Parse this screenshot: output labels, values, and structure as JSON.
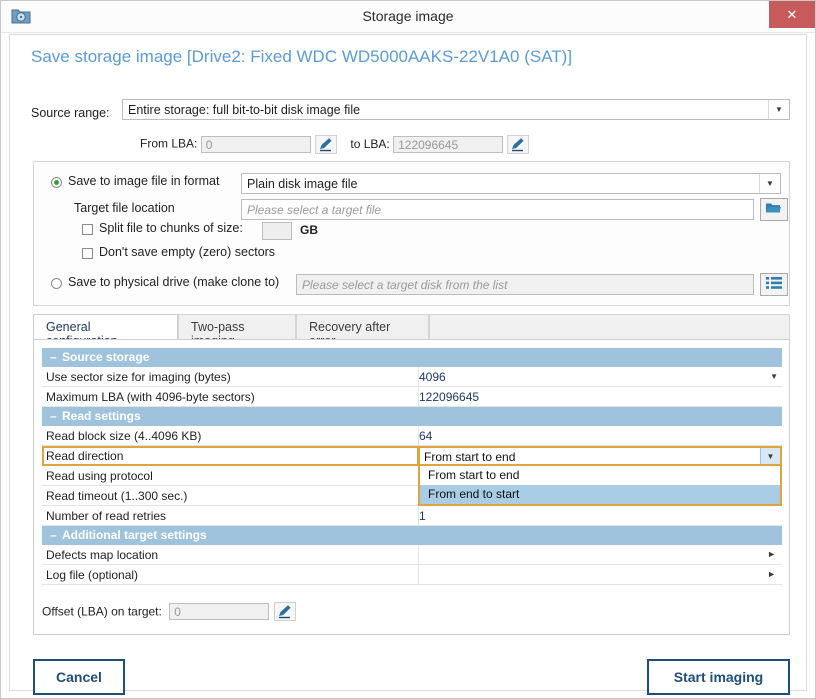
{
  "window": {
    "title": "Storage image",
    "icon": "disk-folder-icon",
    "close_label": "✕",
    "accent_blue": "#5b9bd5",
    "section_header_bg": "#9fc3dd",
    "highlight_orange": "#e0a43c",
    "button_blue": "#1f4e79",
    "close_red": "#c75b5b"
  },
  "heading": "Save storage image [Drive2: Fixed WDC WD5000AAKS-22V1A0 (SAT)]",
  "source_range": {
    "label": "Source range:",
    "value": "Entire storage: full bit-to-bit disk image file",
    "from_label": "From LBA:",
    "from_value": "0",
    "to_label": "to LBA:",
    "to_value": "122096645"
  },
  "target": {
    "save_to_file_label": "Save to image file in format",
    "save_to_file_selected": true,
    "format_value": "Plain disk image file",
    "target_location_label": "Target file location",
    "target_location_placeholder": "Please select a target file",
    "browse_icon": "folder-open-icon",
    "split_label": "Split file to chunks of size:",
    "split_checked": false,
    "split_value": "",
    "gb_label": "GB",
    "no_empty_label": "Don't save empty (zero) sectors",
    "no_empty_checked": false,
    "save_to_drive_label": "Save to physical drive (make clone to)",
    "save_to_drive_selected": false,
    "drive_placeholder": "Please select a target disk from the list",
    "list_icon": "list-select-icon"
  },
  "tabs": [
    {
      "label": "General configuration",
      "active": true
    },
    {
      "label": "Two-pass imaging",
      "active": false
    },
    {
      "label": "Recovery after error",
      "active": false
    }
  ],
  "settings": {
    "sections": [
      {
        "title": "Source storage",
        "collapse_glyph": "–",
        "rows": [
          {
            "key": "Use sector size for imaging (bytes)",
            "value": "4096",
            "control": "combo"
          },
          {
            "key": "Maximum LBA (with 4096-byte sectors)",
            "value": "122096645",
            "control": "text"
          }
        ]
      },
      {
        "title": "Read settings",
        "collapse_glyph": "–",
        "rows": [
          {
            "key": "Read block size (4..4096 KB)",
            "value": "64",
            "control": "text"
          },
          {
            "key": "Read direction",
            "value": "From start to end",
            "control": "open-dropdown"
          },
          {
            "key": "Read using protocol",
            "value": "",
            "control": "text"
          },
          {
            "key": "Read timeout (1..300 sec.)",
            "value": "",
            "control": "text"
          },
          {
            "key": "Number of read retries",
            "value": "1",
            "control": "text"
          }
        ]
      },
      {
        "title": "Additional target settings",
        "collapse_glyph": "–",
        "rows": [
          {
            "key": "Defects map location",
            "value": "",
            "control": "expand"
          },
          {
            "key": "Log file (optional)",
            "value": "",
            "control": "expand"
          }
        ]
      }
    ],
    "open_dropdown": {
      "selected": "From start to end",
      "options": [
        {
          "label": "From start to end",
          "highlighted": false
        },
        {
          "label": "From end to start",
          "highlighted": true
        }
      ]
    },
    "offset": {
      "label": "Offset (LBA) on target:",
      "value": "0"
    }
  },
  "footer": {
    "cancel_label": "Cancel",
    "start_label": "Start imaging"
  }
}
